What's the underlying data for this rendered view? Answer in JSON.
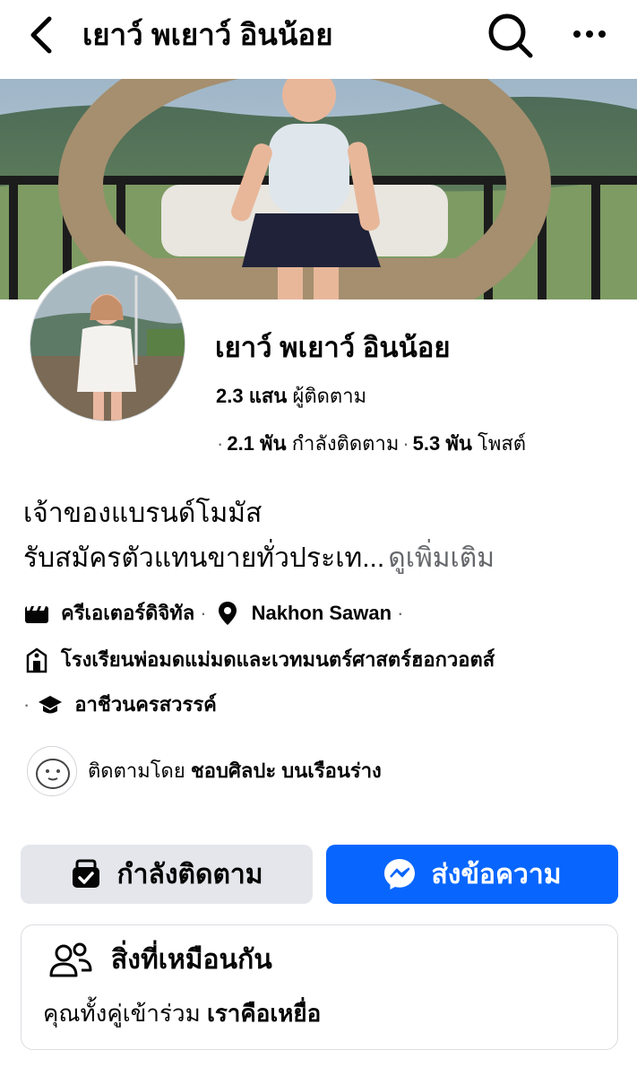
{
  "header": {
    "title": "เยาว์ พเยาว์ อินน้อย",
    "back_icon": "chevron-left-icon",
    "search_icon": "search-icon",
    "more_icon": "more-horizontal-icon"
  },
  "profile": {
    "name": "เยาว์ พเยาว์ อินน้อย",
    "followers_count": "2.3 แสน",
    "followers_label": "ผู้ติดตาม",
    "following_count": "2.1 พัน",
    "following_label": "กำลังติดตาม",
    "posts_count": "5.3 พัน",
    "posts_label": "โพสต์"
  },
  "bio": {
    "line1": "เจ้าของแบรนด์โมมัส",
    "line2": "รับสมัครตัวแทนขายทั่วประเท...",
    "see_more": "ดูเพิ่มเติม"
  },
  "details": {
    "category": "ครีเอเตอร์ดิจิทัล",
    "location": "Nakhon Sawan",
    "school": "โรงเรียนพ่อมดแม่มดและเวทมนตร์ศาสตร์ฮอกวอตส์",
    "college": "อาชีวนครสวรรค์"
  },
  "followed_by": {
    "prefix": "ติดตามโดย",
    "name": "ชอบศิลปะ บนเรือนร่าง"
  },
  "actions": {
    "following_label": "กำลังติดตาม",
    "message_label": "ส่งข้อความ"
  },
  "common": {
    "title": "สิ่งที่เหมือนกัน",
    "prefix": "คุณทั้งคู่เข้าร่วม",
    "group": "เราคือเหยื่อ"
  },
  "colors": {
    "primary": "#0866ff",
    "secondary_button": "#e4e6eb",
    "muted_text": "#65676b"
  }
}
